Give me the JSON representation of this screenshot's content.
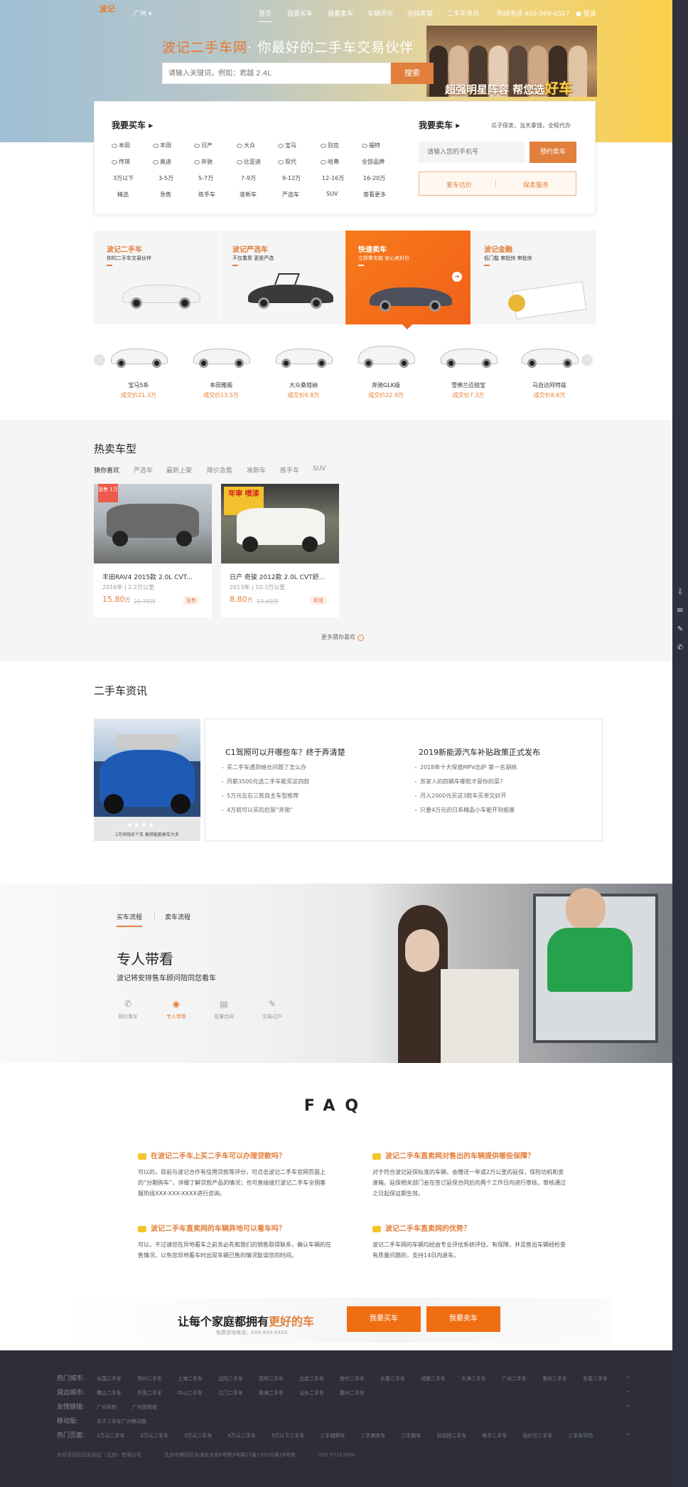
{
  "nav": {
    "logo": "波记",
    "city": "广州",
    "items": [
      "首页",
      "我要买车",
      "我要卖车",
      "车辆评估",
      "在线客服",
      "二手车资讯"
    ],
    "hotline": "热线电话 400-069-6527",
    "login": "登录"
  },
  "hero": {
    "slogan_brand": "波记二手车网",
    "slogan_rest": "· 你最好的二手车交易伙伴",
    "search_placeholder": "请输入关键词，例如：君越 2.4L",
    "search_button": "搜索",
    "banner_text": "超强明星阵容 帮您选",
    "banner_big": "好车"
  },
  "buy": {
    "title": "我要买车",
    "brands_row1": [
      "本田",
      "丰田",
      "日产",
      "大众",
      "宝马",
      "别克",
      "福特"
    ],
    "brands_row2": [
      "传祺",
      "奥迪",
      "奔驰",
      "比亚迪",
      "现代",
      "哈弗",
      "全部品牌"
    ],
    "prices": [
      "3万以下",
      "3-5万",
      "5-7万",
      "7-9万",
      "9-12万",
      "12-16万",
      "16-20万"
    ],
    "types": [
      "精选",
      "急售",
      "练手车",
      "准新车",
      "严选车",
      "SUV",
      "查看更多"
    ]
  },
  "sell": {
    "title": "我要卖车",
    "tagline": "瓜子保卖，当天拿钱，全程代办",
    "phone_placeholder": "请输入您的手机号",
    "appoint_button": "预约卖车",
    "estimate_link": "爱车估价",
    "guarantee_link": "保卖服务"
  },
  "services": [
    {
      "title": "波记二手车",
      "sub": "你的二手车交易伙伴"
    },
    {
      "title": "波记严选车",
      "sub": "不仅重质 更是严选"
    },
    {
      "title": "快速卖车",
      "sub": "立即拿车款 安心卖好价"
    },
    {
      "title": "波记金融",
      "sub": "低门槛 审批快 审批快"
    }
  ],
  "carousel": [
    {
      "name": "宝马5系",
      "price": "成交价21.3万"
    },
    {
      "name": "本田雅阁",
      "price": "成交价13.5万"
    },
    {
      "name": "大众桑塔纳",
      "price": "成交价6.8万"
    },
    {
      "name": "奔驰GLK级",
      "price": "成交价22.9万"
    },
    {
      "name": "雪佛兰迈锐宝",
      "price": "成交价7.3万"
    },
    {
      "name": "马自达阿特兹",
      "price": "成交价8.6万"
    }
  ],
  "hot": {
    "title": "热卖车型",
    "tabs": [
      "猜你喜欢",
      "严选车",
      "最新上架",
      "降价急售",
      "准新车",
      "练手车",
      "SUV"
    ],
    "cars": [
      {
        "badge": "急售 1万",
        "name": "丰田RAV4 2015款 2.0L CVT...",
        "meta": "2016年 | 2.2万公里",
        "price": "15.80",
        "unit": "万",
        "original": "21.70万",
        "tag": "急售"
      },
      {
        "name": "日产 奇骏 2012款 2.0L CVT舒...",
        "meta": "2013年 | 10.3万公里",
        "price": "8.80",
        "unit": "万",
        "original": "23.60万",
        "tag": "超值",
        "banner": "年审 喷漆"
      }
    ],
    "more": "更多猜你喜欢"
  },
  "news": {
    "title": "二手车资讯",
    "image_caption": "1万块钱买个车 竟然能跑高车大夫",
    "col1_head": "C1驾照可以开哪些车？终于弄清楚",
    "col1_items": [
      "买二手车遇到暗仓问题了怎么办",
      "月薪3500元选二手车能买这四款",
      "5万元左右三款自主车型推荐",
      "4万就可以买的后驱“奔驰”"
    ],
    "col2_head": "2019新能源汽车补贴政策正式发布",
    "col2_items": [
      "2018年十大保值MPV出炉 第一名胡桃",
      "苏家人的四辆车哪款才是你的菜？",
      "月入2000元买这3款车买单又好开",
      "只要4万元的日系精品小车能开到报废"
    ]
  },
  "flow": {
    "tabs": [
      "买车流程",
      "卖车流程"
    ],
    "title": "专人带看",
    "subtitle": "波记将安排售车顾问陪同您看车",
    "steps": [
      "预约看车",
      "专人带看",
      "签署合同",
      "交易过户"
    ]
  },
  "faq": {
    "title": "FAQ",
    "items": [
      {
        "q": "在波记二手车上买二手车可以办理贷款吗？",
        "a": "可以的，目前与波记合作有信用贷款等评分，可点击波记二手车官网页面上的“分期购车”，详细了解贷款产品的情况；也可直接拨打波记二手车全国客服热线XXX-XXX-XXXX进行咨询。"
      },
      {
        "q": "波记二手车直卖网对售出的车辆提供哪些保障？",
        "a": "对于符合波记延保标准的车辆，会赠送一年或2万公里的延保，保险功机和变速箱。延保相关部门会在签订延保合同后的两个工作日内进行审核，审核通过之日起保证期生效。"
      },
      {
        "q": "波记二手车直卖网的车辆异地可以看车吗？",
        "a": "可以，不过请您在异地看车之前务必先和我们的销售取得联系，确认车辆的在售情况，以免您异地看车时出现车辆已售的情况耽误您的时间。"
      },
      {
        "q": "波记二手车直卖网的优势？",
        "a": "波记二手车网的车辆均经由专业评估系统评估，有保障，并且售出车辆经检查有质量问题的，支持14日内退车。"
      }
    ]
  },
  "cta": {
    "title_pre": "让每个家庭都拥有",
    "title_highlight": "更好的车",
    "sub": "免费咨询电话：XXX-XXX-XXXX",
    "buy_button": "我要买车",
    "sell_button": "我要卖车"
  },
  "footer": {
    "rows": [
      {
        "label": "热门城市:",
        "links": [
          "全国二手车",
          "郑州二手车",
          "上海二手车",
          "沈阳二手车",
          "昆明二手车",
          "北京二手车",
          "南宁二手车",
          "长春二手车",
          "成都二手车",
          "天津二手车",
          "广州二手车",
          "重庆二手车",
          "东莞二手车"
        ]
      },
      {
        "label": "周边城市:",
        "links": [
          "佛山二手车",
          "东莞二手车",
          "中山二手车",
          "江门二手车",
          "珠海二手车",
          "汕头二手车",
          "惠州二手车"
        ]
      },
      {
        "label": "友情链接:",
        "links": [
          "广州驾校",
          "广州团驾驶"
        ]
      },
      {
        "label": "移动版:",
        "links": [
          "瓜子二手车广州移动版"
        ]
      },
      {
        "label": "热门页面:",
        "links": [
          "1万元二手车",
          "2万元二手车",
          "3万元二手车",
          "4万元二手车",
          "5万以下二手车",
          "二手越野车",
          "二手商务车",
          "二手跑车",
          "自动挡二手车",
          "练手二手车",
          "低价位二手车",
          "二手车评估"
        ]
      }
    ],
    "copyright": [
      "车好多旧机动车经纪（北京）有限公司",
      "北京市朝阳区阜通东大街6号院3号楼17层1701内第18号房",
      "010-57317000"
    ]
  }
}
